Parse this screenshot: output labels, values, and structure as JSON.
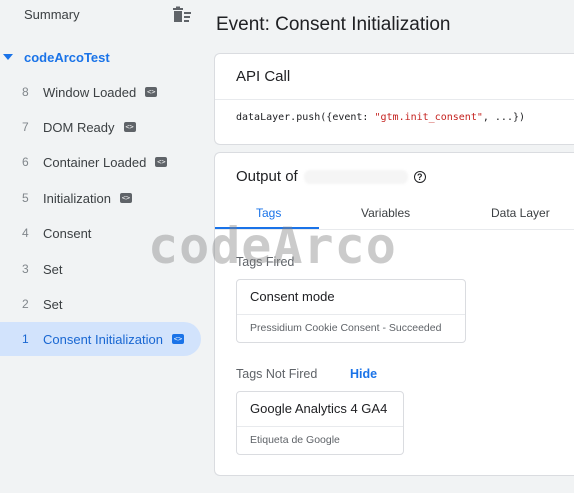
{
  "sidebar": {
    "summary_label": "Summary",
    "trash_icon": "delete-sweep-icon",
    "container_name": "codeArcoTest",
    "events": [
      {
        "num": "8",
        "name": "Window Loaded",
        "badge": "<>"
      },
      {
        "num": "7",
        "name": "DOM Ready",
        "badge": "<>"
      },
      {
        "num": "6",
        "name": "Container Loaded",
        "badge": "<>"
      },
      {
        "num": "5",
        "name": "Initialization",
        "badge": "<>"
      },
      {
        "num": "4",
        "name": "Consent",
        "badge": ""
      },
      {
        "num": "3",
        "name": "Set",
        "badge": ""
      },
      {
        "num": "2",
        "name": "Set",
        "badge": ""
      },
      {
        "num": "1",
        "name": "Consent Initialization",
        "badge": "<>"
      }
    ]
  },
  "main": {
    "title": "Event: Consent Initialization",
    "api_call": {
      "heading": "API Call",
      "code_prefix": "dataLayer.push({event: ",
      "code_string": "\"gtm.init_consent\"",
      "code_suffix": ", ...})"
    },
    "output": {
      "heading": "Output of",
      "help_glyph": "?",
      "tabs": [
        "Tags",
        "Variables",
        "Data Layer"
      ],
      "tags_fired_label": "Tags Fired",
      "tags_fired": [
        {
          "name": "Consent mode",
          "status": "Pressidium Cookie Consent - Succeeded"
        }
      ],
      "tags_not_fired_label": "Tags Not Fired",
      "hide_label": "Hide",
      "tags_not_fired": [
        {
          "name": "Google Analytics 4 GA4",
          "status": "Etiqueta de Google"
        }
      ]
    }
  },
  "watermark": "codeArco",
  "colors": {
    "accent": "#1a73e8",
    "selected_bg": "#d2e3fc",
    "page_bg": "#f1f3f4"
  }
}
